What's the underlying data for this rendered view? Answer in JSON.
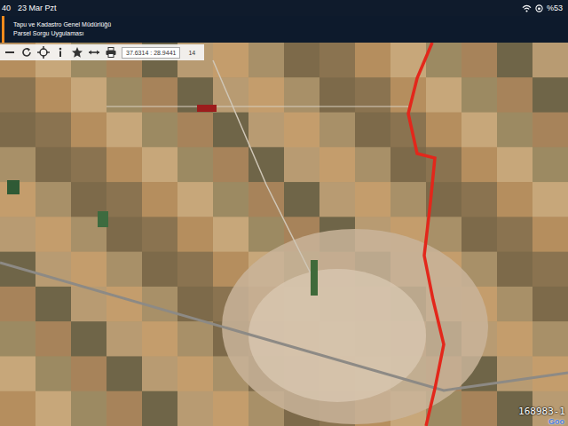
{
  "status_bar": {
    "time": "40",
    "date": "23 Mar Pzt",
    "battery": "%53"
  },
  "header": {
    "title": "Tapu ve Kadastro Genel Müdürlüğü",
    "subtitle": "Parsel Sorgu Uygulaması"
  },
  "toolbar": {
    "coordinates": "37.6314 : 28.9441",
    "zoom": "14"
  },
  "map": {
    "parcel_label": "168983-1",
    "attribution": "Goo"
  }
}
